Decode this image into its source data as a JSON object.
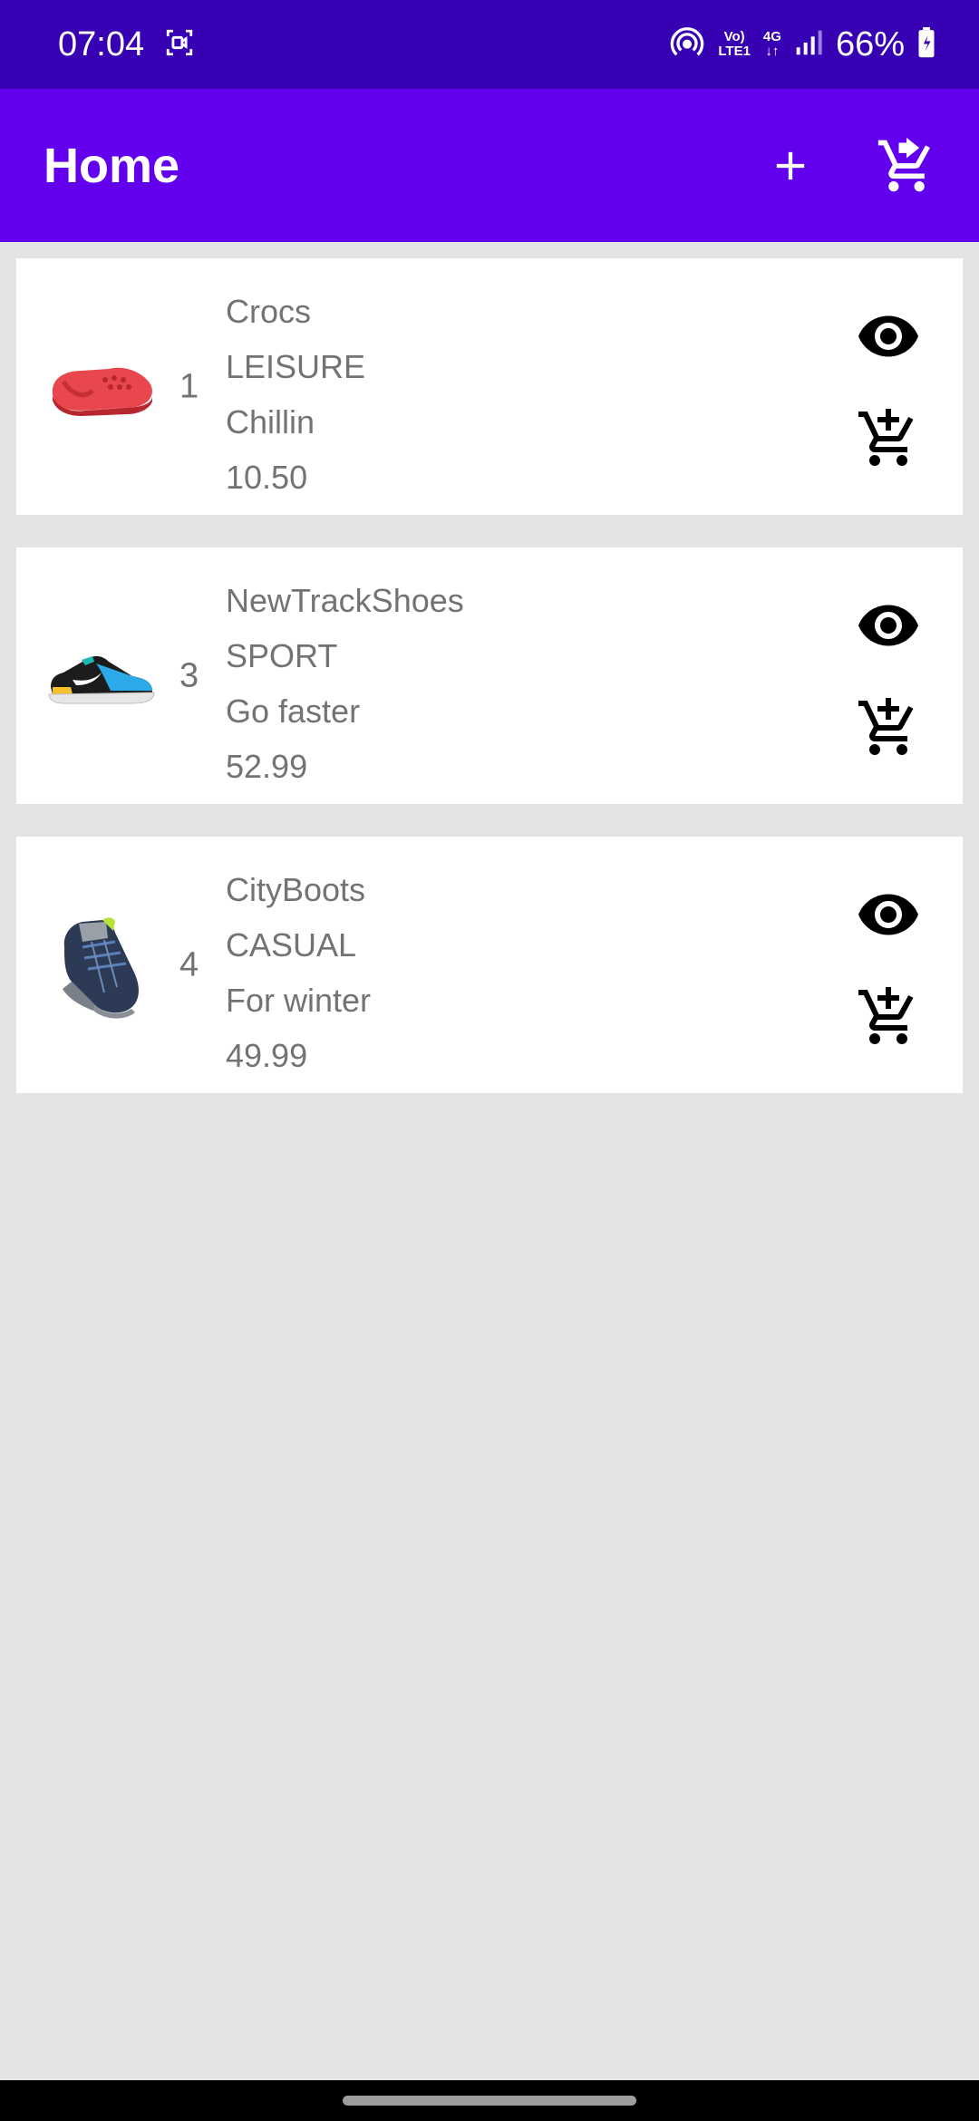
{
  "status_bar": {
    "time": "07:04",
    "network_top": "Vo)",
    "network_bottom": "LTE1",
    "network_type": "4G",
    "battery": "66%",
    "icons": [
      "screen-record-icon",
      "hotspot-icon",
      "signal-icon",
      "battery-charging-icon"
    ]
  },
  "app_bar": {
    "title": "Home",
    "actions": [
      "add-icon",
      "cart-checkout-icon"
    ],
    "background": "#6200ee",
    "status_background": "#3700b3"
  },
  "products": [
    {
      "id": "1",
      "name": "Crocs",
      "category": "LEISURE",
      "description": "Chillin",
      "price": "10.50",
      "image": "red-clog-shoe"
    },
    {
      "id": "3",
      "name": "NewTrackShoes",
      "category": "SPORT",
      "description": "Go faster",
      "price": "52.99",
      "image": "blue-sneaker"
    },
    {
      "id": "4",
      "name": "CityBoots",
      "category": "CASUAL",
      "description": "For winter",
      "price": "49.99",
      "image": "grey-kids-shoe"
    }
  ]
}
